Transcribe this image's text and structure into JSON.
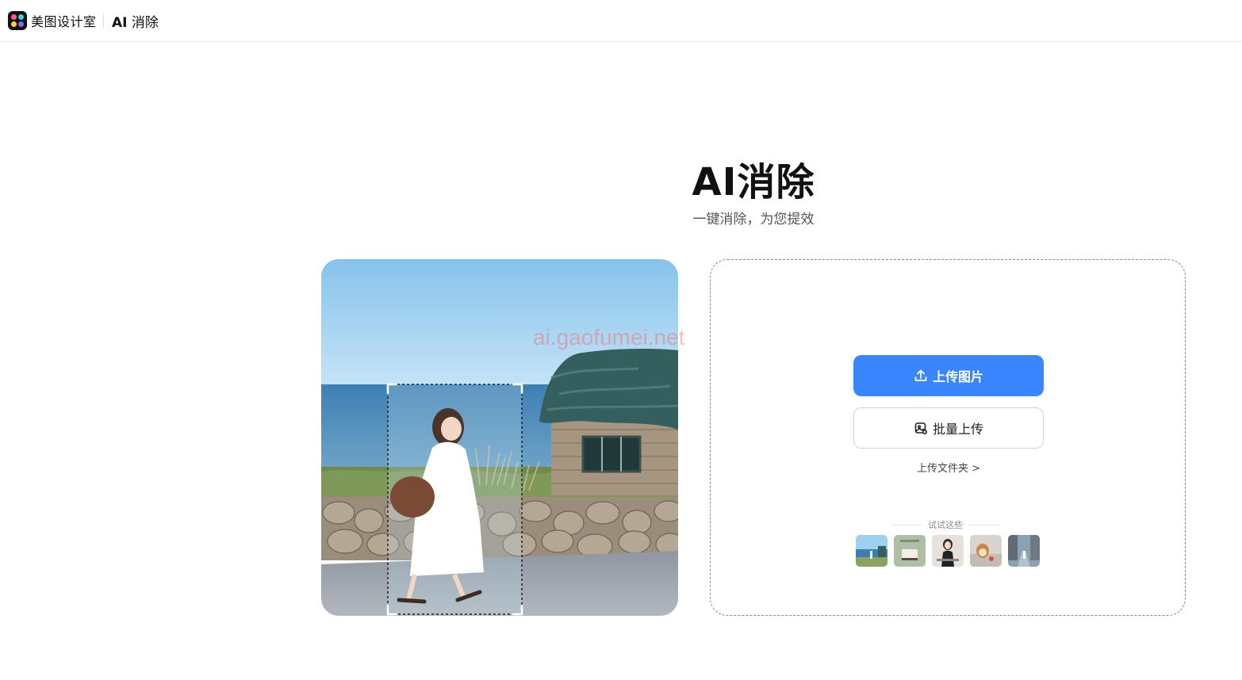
{
  "header": {
    "brand": "美图设计室",
    "product_prefix": "AI",
    "product_suffix": "消除"
  },
  "hero": {
    "title": "AI消除",
    "subtitle": "一键消除，为您提效"
  },
  "watermark": "ai.gaofumei.net",
  "upload": {
    "primary_label": "上传图片",
    "secondary_label": "批量上传",
    "folder_label": "上传文件夹 >",
    "try_label": "试试这些"
  },
  "icons": {
    "upload": "upload-arrow-icon",
    "batch": "image-stack-icon"
  },
  "colors": {
    "accent": "#3a86ff"
  }
}
